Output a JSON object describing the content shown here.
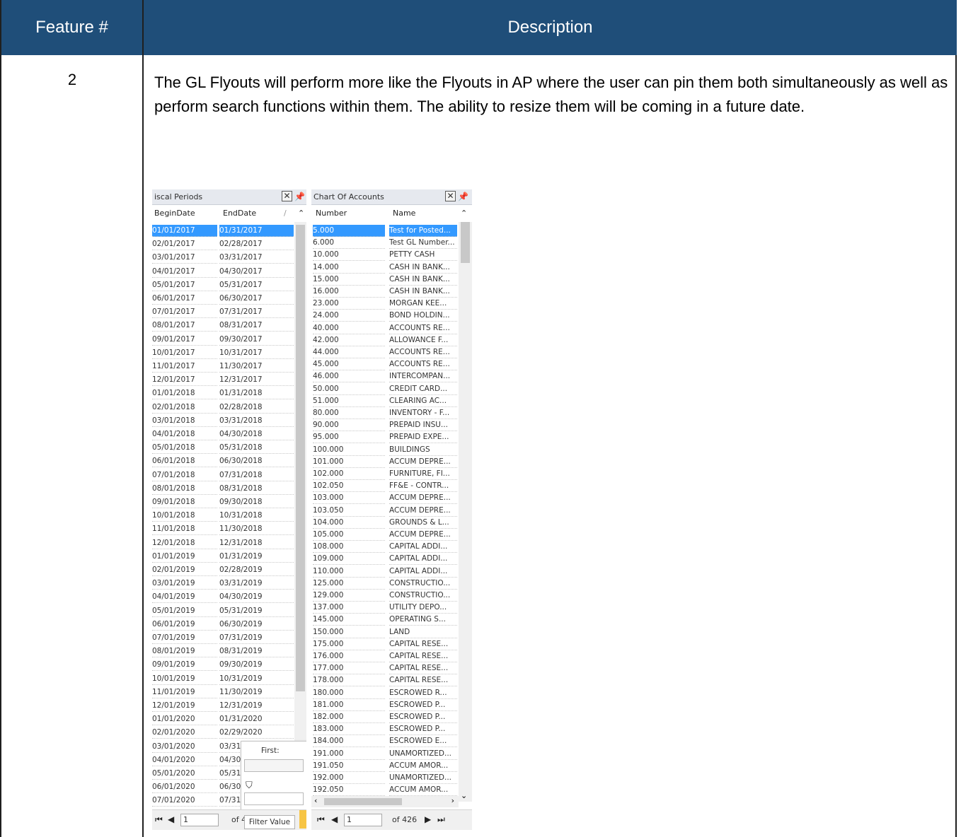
{
  "table": {
    "header_feature": "Feature #",
    "header_description": "Description",
    "feature_number": "2",
    "description": "The GL Flyouts will perform more like the Flyouts in AP where the user can pin them both simultaneously as well as perform search functions within them. The ability to resize them will be coming in a future date."
  },
  "fiscal_periods": {
    "title": "iscal Periods",
    "col_begin": "BeginDate",
    "col_end": "EndDate",
    "sort_glyph": "/",
    "rows": [
      [
        "01/01/2017",
        "01/31/2017"
      ],
      [
        "02/01/2017",
        "02/28/2017"
      ],
      [
        "03/01/2017",
        "03/31/2017"
      ],
      [
        "04/01/2017",
        "04/30/2017"
      ],
      [
        "05/01/2017",
        "05/31/2017"
      ],
      [
        "06/01/2017",
        "06/30/2017"
      ],
      [
        "07/01/2017",
        "07/31/2017"
      ],
      [
        "08/01/2017",
        "08/31/2017"
      ],
      [
        "09/01/2017",
        "09/30/2017"
      ],
      [
        "10/01/2017",
        "10/31/2017"
      ],
      [
        "11/01/2017",
        "11/30/2017"
      ],
      [
        "12/01/2017",
        "12/31/2017"
      ],
      [
        "01/01/2018",
        "01/31/2018"
      ],
      [
        "02/01/2018",
        "02/28/2018"
      ],
      [
        "03/01/2018",
        "03/31/2018"
      ],
      [
        "04/01/2018",
        "04/30/2018"
      ],
      [
        "05/01/2018",
        "05/31/2018"
      ],
      [
        "06/01/2018",
        "06/30/2018"
      ],
      [
        "07/01/2018",
        "07/31/2018"
      ],
      [
        "08/01/2018",
        "08/31/2018"
      ],
      [
        "09/01/2018",
        "09/30/2018"
      ],
      [
        "10/01/2018",
        "10/31/2018"
      ],
      [
        "11/01/2018",
        "11/30/2018"
      ],
      [
        "12/01/2018",
        "12/31/2018"
      ],
      [
        "01/01/2019",
        "01/31/2019"
      ],
      [
        "02/01/2019",
        "02/28/2019"
      ],
      [
        "03/01/2019",
        "03/31/2019"
      ],
      [
        "04/01/2019",
        "04/30/2019"
      ],
      [
        "05/01/2019",
        "05/31/2019"
      ],
      [
        "06/01/2019",
        "06/30/2019"
      ],
      [
        "07/01/2019",
        "07/31/2019"
      ],
      [
        "08/01/2019",
        "08/31/2019"
      ],
      [
        "09/01/2019",
        "09/30/2019"
      ],
      [
        "10/01/2019",
        "10/31/2019"
      ],
      [
        "11/01/2019",
        "11/30/2019"
      ],
      [
        "12/01/2019",
        "12/31/2019"
      ],
      [
        "01/01/2020",
        "01/31/2020"
      ],
      [
        "02/01/2020",
        "02/29/2020"
      ],
      [
        "03/01/2020",
        "03/31"
      ],
      [
        "04/01/2020",
        "04/30"
      ],
      [
        "05/01/2020",
        "05/31"
      ],
      [
        "06/01/2020",
        "06/30"
      ],
      [
        "07/01/2020",
        "07/31"
      ]
    ],
    "selected_index": 0,
    "page_value": "1",
    "of_text": "of 4",
    "filter_first_label": "First:",
    "filter_tooltip": "Filter Value"
  },
  "chart_of_accounts": {
    "title": "Chart Of Accounts",
    "col_number": "Number",
    "col_name": "Name",
    "rows": [
      [
        "5.000",
        "Test for Posted..."
      ],
      [
        "6.000",
        "Test GL Number..."
      ],
      [
        "10.000",
        "PETTY CASH"
      ],
      [
        "14.000",
        "CASH IN BANK..."
      ],
      [
        "15.000",
        "CASH IN BANK..."
      ],
      [
        "16.000",
        "CASH IN BANK..."
      ],
      [
        "23.000",
        "MORGAN KEE..."
      ],
      [
        "24.000",
        "BOND HOLDIN..."
      ],
      [
        "40.000",
        "ACCOUNTS RE..."
      ],
      [
        "42.000",
        "ALLOWANCE F..."
      ],
      [
        "44.000",
        "ACCOUNTS RE..."
      ],
      [
        "45.000",
        "ACCOUNTS RE..."
      ],
      [
        "46.000",
        "INTERCOMPAN..."
      ],
      [
        "50.000",
        "CREDIT CARD..."
      ],
      [
        "51.000",
        "CLEARING AC..."
      ],
      [
        "80.000",
        "INVENTORY - F..."
      ],
      [
        "90.000",
        "PREPAID INSU..."
      ],
      [
        "95.000",
        "PREPAID EXPE..."
      ],
      [
        "100.000",
        "BUILDINGS"
      ],
      [
        "101.000",
        "ACCUM DEPRE..."
      ],
      [
        "102.000",
        "FURNITURE, FI..."
      ],
      [
        "102.050",
        "FF&E - CONTR..."
      ],
      [
        "103.000",
        "ACCUM DEPRE..."
      ],
      [
        "103.050",
        "ACCUM DEPRE..."
      ],
      [
        "104.000",
        "GROUNDS & L..."
      ],
      [
        "105.000",
        "ACCUM DEPRE..."
      ],
      [
        "108.000",
        "CAPITAL ADDI..."
      ],
      [
        "109.000",
        "CAPITAL ADDI..."
      ],
      [
        "110.000",
        "CAPITAL ADDI..."
      ],
      [
        "125.000",
        "CONSTRUCTIO..."
      ],
      [
        "129.000",
        "CONSTRUCTIO..."
      ],
      [
        "137.000",
        "UTILITY DEPO..."
      ],
      [
        "145.000",
        "OPERATING S..."
      ],
      [
        "150.000",
        "LAND"
      ],
      [
        "175.000",
        "CAPITAL RESE..."
      ],
      [
        "176.000",
        "CAPITAL RESE..."
      ],
      [
        "177.000",
        "CAPITAL RESE..."
      ],
      [
        "178.000",
        "CAPITAL RESE..."
      ],
      [
        "180.000",
        "ESCROWED R..."
      ],
      [
        "181.000",
        "ESCROWED P..."
      ],
      [
        "182.000",
        "ESCROWED P..."
      ],
      [
        "183.000",
        "ESCROWED P..."
      ],
      [
        "184.000",
        "ESCROWED E..."
      ],
      [
        "191.000",
        "UNAMORTIZED..."
      ],
      [
        "191.050",
        "ACCUM AMOR..."
      ],
      [
        "192.000",
        "UNAMORTIZED..."
      ],
      [
        "192.050",
        "ACCUM AMOR..."
      ]
    ],
    "selected_index": 0,
    "page_value": "1",
    "of_text": "of 426"
  },
  "colors": {
    "header_bg": "#1f4e79",
    "selection": "#3399ff"
  }
}
